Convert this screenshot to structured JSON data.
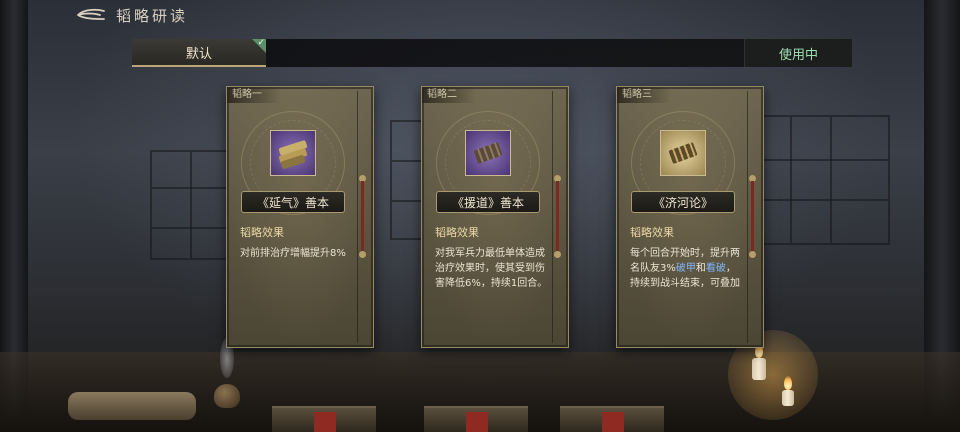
{
  "header": {
    "title": "韬略研读"
  },
  "tabs": {
    "default_label": "默认",
    "status_label": "使用中"
  },
  "cards": [
    {
      "tag": "韬略一",
      "name": "《延气》善本",
      "effect_title": "韬略效果",
      "description": "对前排治疗增幅提升8%",
      "icon": "purple-book-bundle-icon"
    },
    {
      "tag": "韬略二",
      "name": "《援道》善本",
      "effect_title": "韬略效果",
      "description": "对我军兵力最低单体造成治疗效果时，使其受到伤害降低6%，持续1回合。",
      "icon": "purple-bamboo-scroll-icon"
    },
    {
      "tag": "韬略三",
      "name": "《济河论》",
      "effect_title": "韬略效果",
      "description_parts": {
        "a": "每个回合开始时，提升两名队友3%",
        "b": "破甲",
        "c": "和",
        "d": "看破",
        "e": "，持续到战斗结束，可叠加"
      },
      "icon": "gold-bamboo-scroll-icon"
    }
  ],
  "colors": {
    "status_green": "#9fe0b2",
    "keyword_blue": "#7fb6ff",
    "accent_gold": "#b8a676"
  }
}
